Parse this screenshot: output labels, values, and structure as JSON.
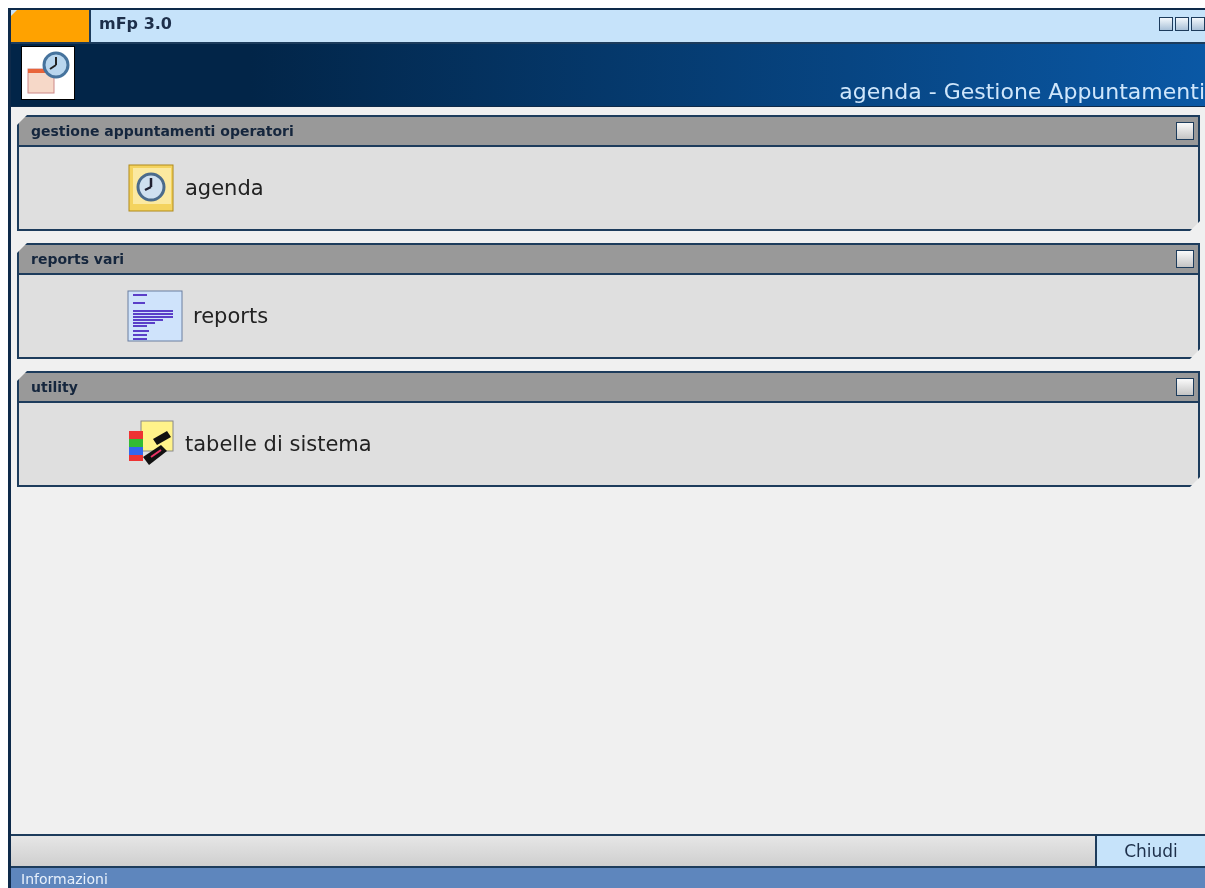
{
  "window": {
    "title": "mFp 3.0"
  },
  "header": {
    "title": "agenda - Gestione Appuntamenti"
  },
  "sections": [
    {
      "title": "gestione appuntamenti operatori",
      "items": [
        {
          "label": "agenda",
          "kind": "clock"
        }
      ]
    },
    {
      "title": "reports vari",
      "items": [
        {
          "label": "reports",
          "kind": "report"
        }
      ]
    },
    {
      "title": "utility",
      "items": [
        {
          "label": "tabelle di sistema",
          "kind": "tools"
        }
      ]
    }
  ],
  "buttons": [
    "Chiudi"
  ],
  "status_bar": "Informazioni"
}
